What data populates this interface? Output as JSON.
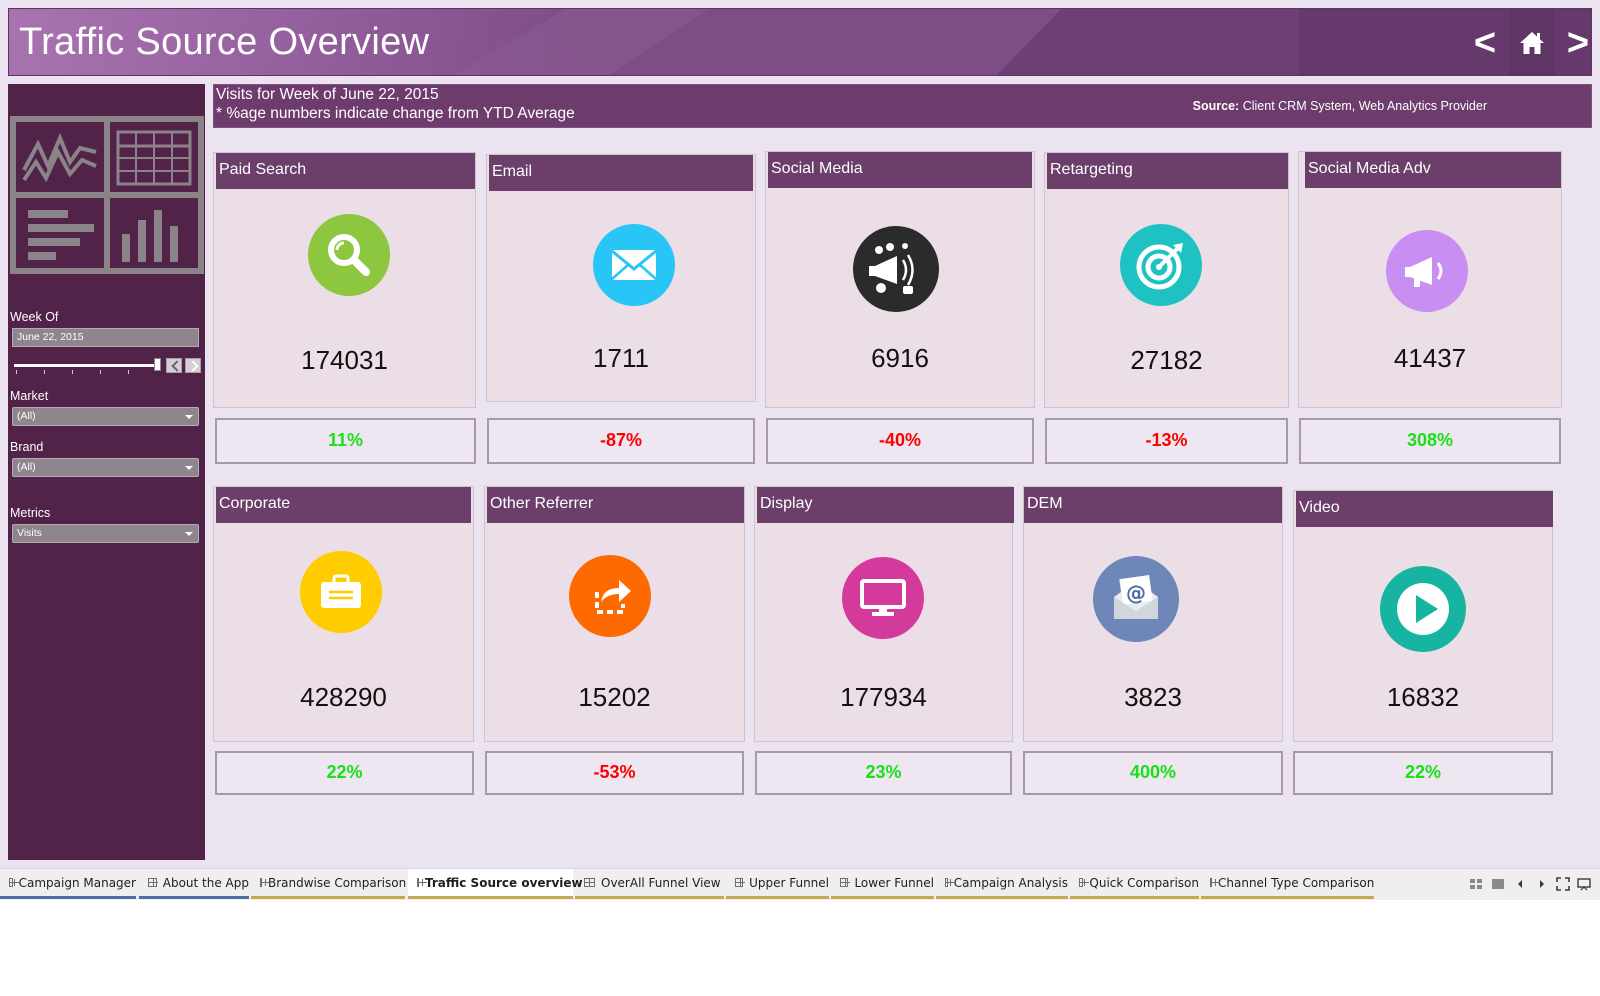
{
  "header": {
    "title": "Traffic Source Overview",
    "nav_prev": "<",
    "nav_next": ">",
    "nav_home_icon": "home-icon"
  },
  "info": {
    "line1": "Visits for Week of June 22, 2015",
    "line2": "* %age numbers indicate change from YTD Average",
    "source_label": "Source:",
    "source_value": "Client CRM System, Web Analytics Provider"
  },
  "filters": {
    "week_label": "Week Of",
    "week_value": "June 22, 2015",
    "market_label": "Market",
    "market_value": "(All)",
    "brand_label": "Brand",
    "brand_value": "(All)",
    "metrics_label": "Metrics",
    "metrics_value": "Visits"
  },
  "colors": {
    "positive": "#19e019",
    "negative": "#ff0000",
    "tile_header": "#6c3f6b",
    "sidebar": "#522349"
  },
  "tiles": [
    {
      "name": "Paid Search",
      "value": "174031",
      "change": "11%",
      "trend": "positive",
      "icon": "magnifier-icon",
      "icon_color": "#8dc63f"
    },
    {
      "name": "Email",
      "value": "1711",
      "change": "-87%",
      "trend": "negative",
      "icon": "envelope-icon",
      "icon_color": "#29c5f6"
    },
    {
      "name": "Social Media",
      "value": "6916",
      "change": "-40%",
      "trend": "negative",
      "icon": "megaphone-social-icon",
      "icon_color": "#2b2b2b"
    },
    {
      "name": "Retargeting",
      "value": "27182",
      "change": "-13%",
      "trend": "negative",
      "icon": "target-icon",
      "icon_color": "#1fc2c2"
    },
    {
      "name": "Social Media Adv",
      "value": "41437",
      "change": "308%",
      "trend": "positive",
      "icon": "megaphone-icon",
      "icon_color": "#c88ef2"
    },
    {
      "name": "Corporate",
      "value": "428290",
      "change": "22%",
      "trend": "positive",
      "icon": "briefcase-icon",
      "icon_color": "#ffcc00"
    },
    {
      "name": "Other Referrer",
      "value": "15202",
      "change": "-53%",
      "trend": "negative",
      "icon": "share-arrow-icon",
      "icon_color": "#ff6a00"
    },
    {
      "name": "Display",
      "value": "177934",
      "change": "23%",
      "trend": "positive",
      "icon": "monitor-icon",
      "icon_color": "#d43a9c"
    },
    {
      "name": "DEM",
      "value": "3823",
      "change": "400%",
      "trend": "positive",
      "icon": "email-at-icon",
      "icon_color": "#6f87b8"
    },
    {
      "name": "Video",
      "value": "16832",
      "change": "22%",
      "trend": "positive",
      "icon": "play-icon",
      "icon_color": "#18b4a2"
    }
  ],
  "tabs": [
    {
      "label": "Campaign Manager",
      "active": false
    },
    {
      "label": "About the App",
      "active": false
    },
    {
      "label": "Brandwise Comparison",
      "active": false
    },
    {
      "label": "Traffic Source overview",
      "active": true
    },
    {
      "label": "OverAll Funnel View",
      "active": false
    },
    {
      "label": "Upper Funnel",
      "active": false
    },
    {
      "label": "Lower Funnel",
      "active": false
    },
    {
      "label": "Campaign Analysis",
      "active": false
    },
    {
      "label": "Quick Comparison",
      "active": false
    },
    {
      "label": "Channel Type Comparison",
      "active": false
    }
  ]
}
